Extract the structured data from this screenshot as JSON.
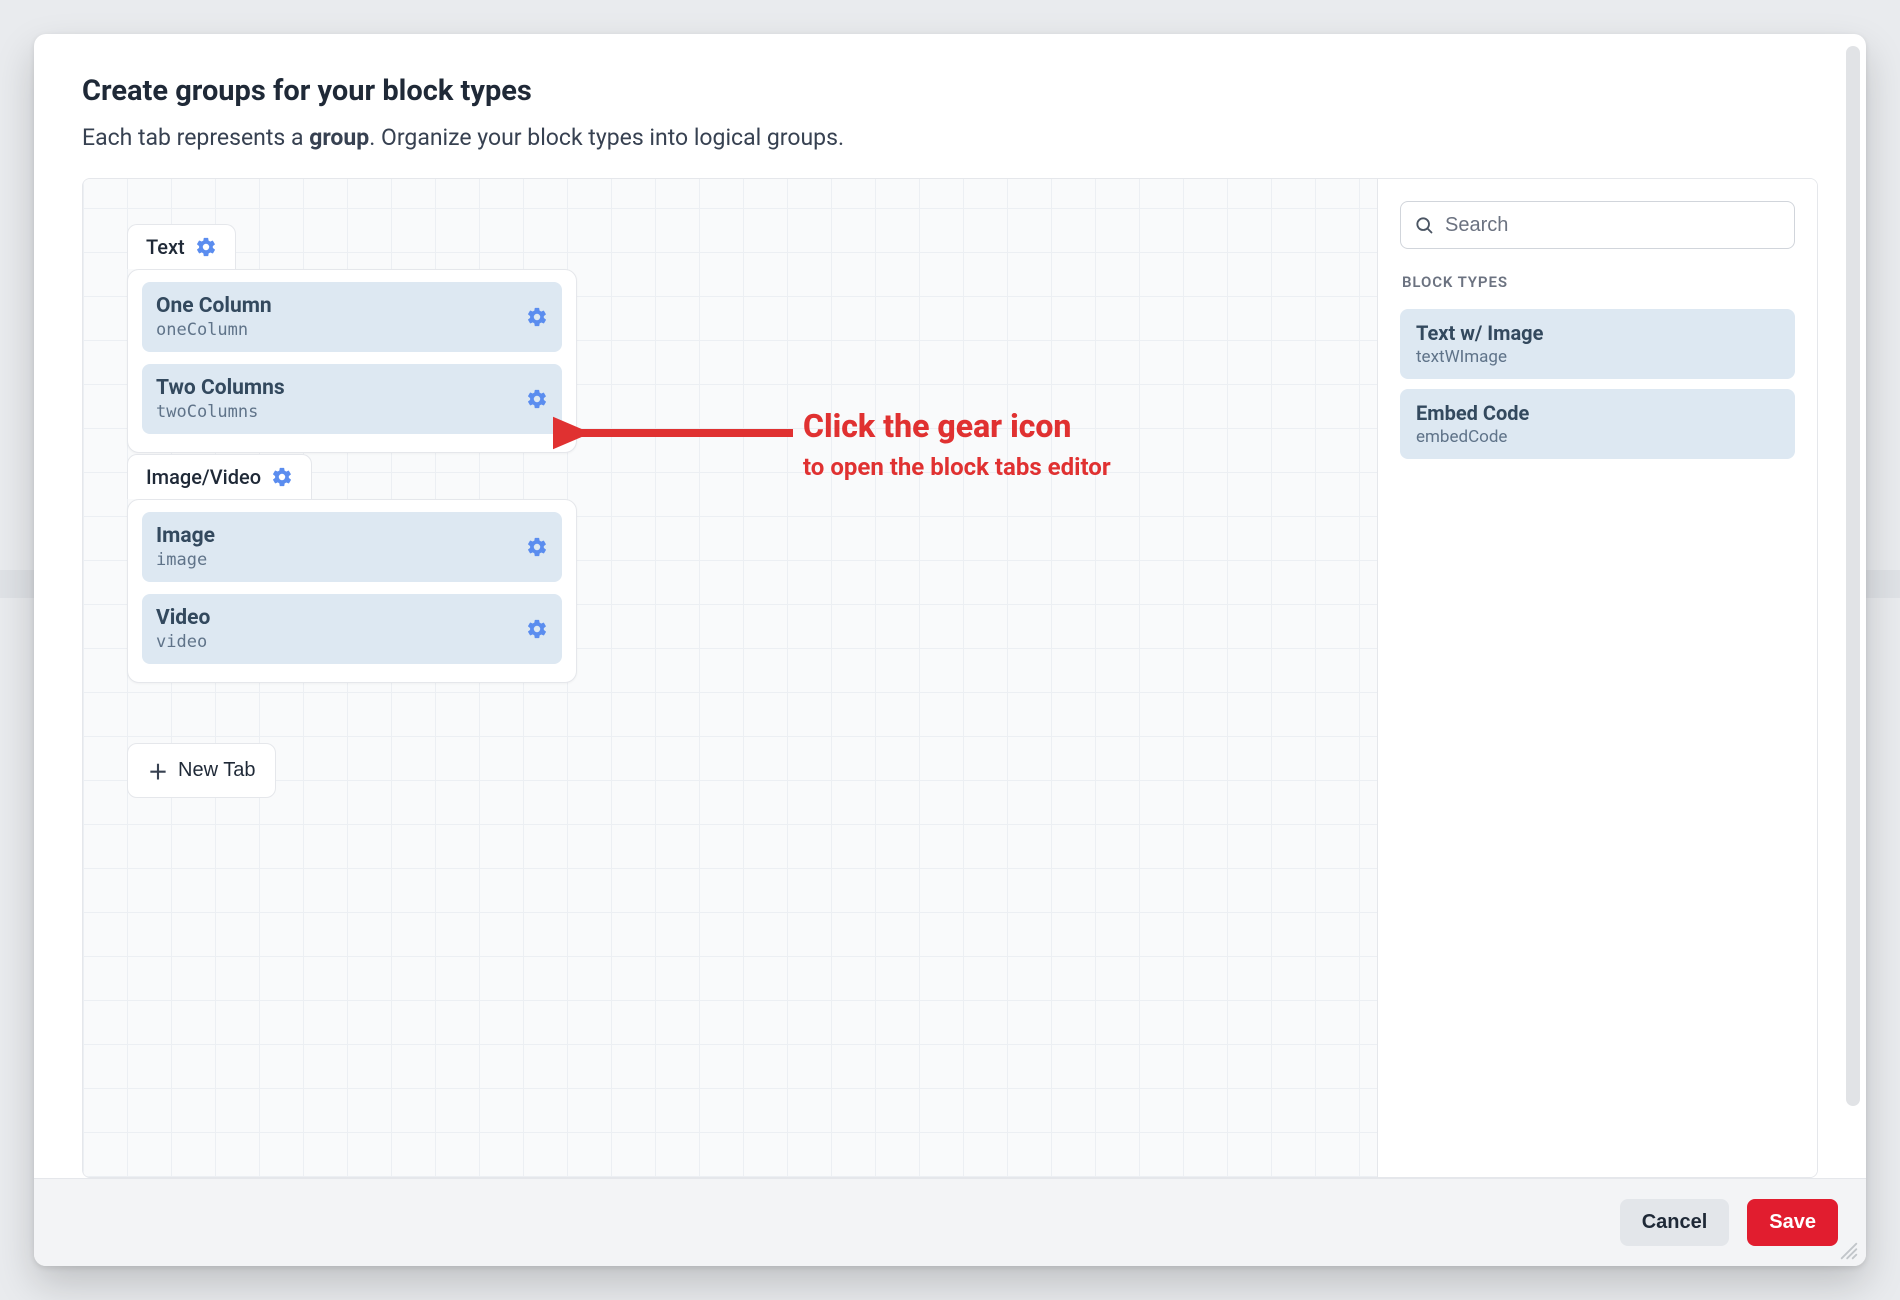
{
  "colors": {
    "accent_blue": "#5b8def",
    "annotation_red": "#e03131",
    "primary_button": "#e11d2f",
    "block_item_bg": "#dde8f2"
  },
  "modal": {
    "title": "Create groups for your block types",
    "description_pre": "Each tab represents a ",
    "description_bold": "group",
    "description_post": ". Organize your block types into logical groups."
  },
  "tabs": [
    {
      "label": "Text",
      "items": [
        {
          "title": "One Column",
          "handle": "oneColumn"
        },
        {
          "title": "Two Columns",
          "handle": "twoColumns"
        }
      ]
    },
    {
      "label": "Image/Video",
      "items": [
        {
          "title": "Image",
          "handle": "image"
        },
        {
          "title": "Video",
          "handle": "video"
        }
      ]
    }
  ],
  "new_tab_label": "New Tab",
  "search": {
    "placeholder": "Search"
  },
  "side_panel": {
    "heading": "BLOCK TYPES",
    "items": [
      {
        "title": "Text w/ Image",
        "handle": "textWImage"
      },
      {
        "title": "Embed Code",
        "handle": "embedCode"
      }
    ]
  },
  "footer": {
    "cancel": "Cancel",
    "save": "Save"
  },
  "annotation": {
    "line1": "Click the gear icon",
    "line2": "to open the block tabs editor"
  }
}
